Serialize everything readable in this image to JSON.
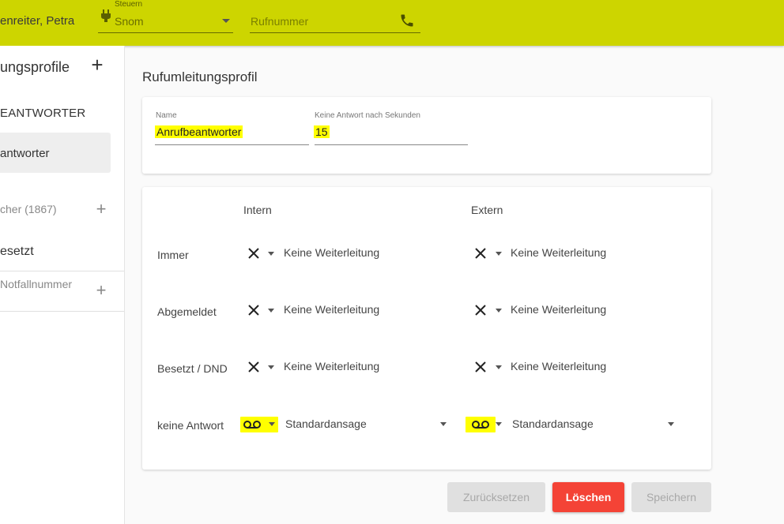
{
  "header": {
    "user_name": "enreiter, Petra",
    "control_label": "Steuern",
    "control_value": "Snom",
    "phone_placeholder": "Rufnummer"
  },
  "sidebar": {
    "title": "ungsprofile",
    "answering_header": "EANTWORTER",
    "answering_item": "antworter",
    "phone_item": "cher (1867)",
    "busy_item": "esetzt",
    "emergency_item": "Notfallnummer"
  },
  "main": {
    "title": "Rufumleitungsprofil",
    "name_label": "Name",
    "name_value": "Anrufbeantworter",
    "timeout_label": "Keine Antwort nach Sekunden",
    "timeout_value": "15",
    "col_intern": "Intern",
    "col_extern": "Extern",
    "rows": [
      {
        "label": "Immer",
        "intern_icon": "close-icon",
        "intern": "Keine Weiterleitung",
        "extern_icon": "close-icon",
        "extern": "Keine Weiterleitung"
      },
      {
        "label": "Abgemeldet",
        "intern_icon": "close-icon",
        "intern": "Keine Weiterleitung",
        "extern_icon": "close-icon",
        "extern": "Keine Weiterleitung"
      },
      {
        "label": "Besetzt / DND",
        "intern_icon": "close-icon",
        "intern": "Keine Weiterleitung",
        "extern_icon": "close-icon",
        "extern": "Keine Weiterleitung"
      },
      {
        "label": "keine Antwort",
        "intern_icon": "voicemail-icon",
        "intern": "Standardansage",
        "extern_icon": "voicemail-icon",
        "extern": "Standardansage"
      }
    ]
  },
  "buttons": {
    "reset": "Zurücksetzen",
    "delete": "Löschen",
    "save": "Speichern"
  },
  "colors": {
    "topbar": "#cdd500",
    "highlight": "#ffff00",
    "delete": "#f44336"
  }
}
